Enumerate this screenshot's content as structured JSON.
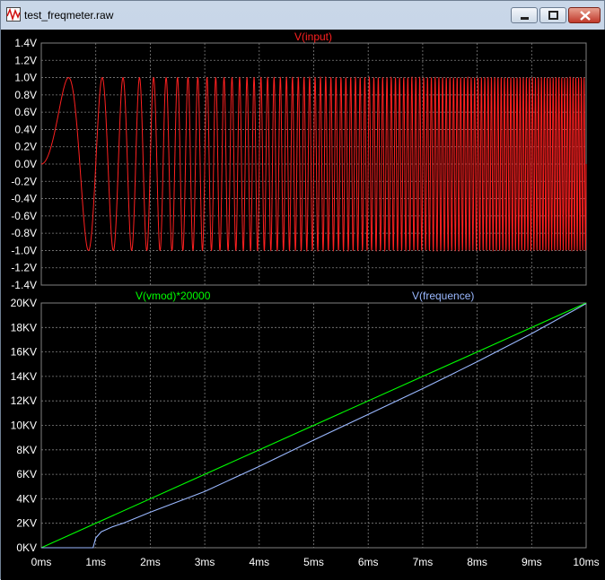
{
  "window": {
    "title": "test_freqmeter.raw"
  },
  "colors": {
    "background": "#000000",
    "grid": "#808080",
    "axis_text": "#ffffff",
    "input": "#ff2020",
    "vmod": "#00ff00",
    "frequence": "#9ab8ff"
  },
  "chart_data": [
    {
      "type": "line",
      "title": "V(input)",
      "x": {
        "min": 0,
        "max": 10,
        "unit": "ms"
      },
      "ylim": [
        -1.4,
        1.4
      ],
      "y_ticks": [
        "1.4V",
        "1.2V",
        "1.0V",
        "0.8V",
        "0.6V",
        "0.4V",
        "0.2V",
        "0.0V",
        "-0.2V",
        "-0.4V",
        "-0.6V",
        "-0.8V",
        "-1.0V",
        "-1.2V",
        "-1.4V"
      ],
      "series": [
        {
          "name": "V(input)",
          "color": "#ff2020",
          "shape": "chirp sine, amplitude 1.0 V, frequency rising linearly with time (period ≈ 1.1 ms at start)",
          "amplitude": 1.0,
          "chirp_rate_hz_per_ms": 2000,
          "start_freq_hz": 0
        }
      ],
      "grid": true
    },
    {
      "type": "line",
      "title": "",
      "x": {
        "min": 0,
        "max": 10,
        "unit": "ms"
      },
      "x_ticks": [
        "0ms",
        "1ms",
        "2ms",
        "3ms",
        "4ms",
        "5ms",
        "6ms",
        "7ms",
        "8ms",
        "9ms",
        "10ms"
      ],
      "ylim": [
        0,
        20000
      ],
      "y_ticks": [
        "20KV",
        "18KV",
        "16KV",
        "14KV",
        "12KV",
        "10KV",
        "8KV",
        "6KV",
        "4KV",
        "2KV",
        "0KV"
      ],
      "series": [
        {
          "name": "V(vmod)*20000",
          "color": "#00ff00",
          "points": [
            [
              0,
              0
            ],
            [
              10,
              20000
            ]
          ]
        },
        {
          "name": "V(frequence)",
          "color": "#9ab8ff",
          "points": [
            [
              0,
              0
            ],
            [
              0.95,
              0
            ],
            [
              1.0,
              800
            ],
            [
              1.1,
              1300
            ],
            [
              1.2,
              1500
            ],
            [
              1.3,
              1700
            ],
            [
              1.5,
              2000
            ],
            [
              2,
              2900
            ],
            [
              3,
              4600
            ],
            [
              4,
              6650
            ],
            [
              5,
              8800
            ],
            [
              6,
              10900
            ],
            [
              7,
              13000
            ],
            [
              8,
              15200
            ],
            [
              9,
              17500
            ],
            [
              10,
              19950
            ]
          ]
        }
      ],
      "grid": true
    }
  ]
}
